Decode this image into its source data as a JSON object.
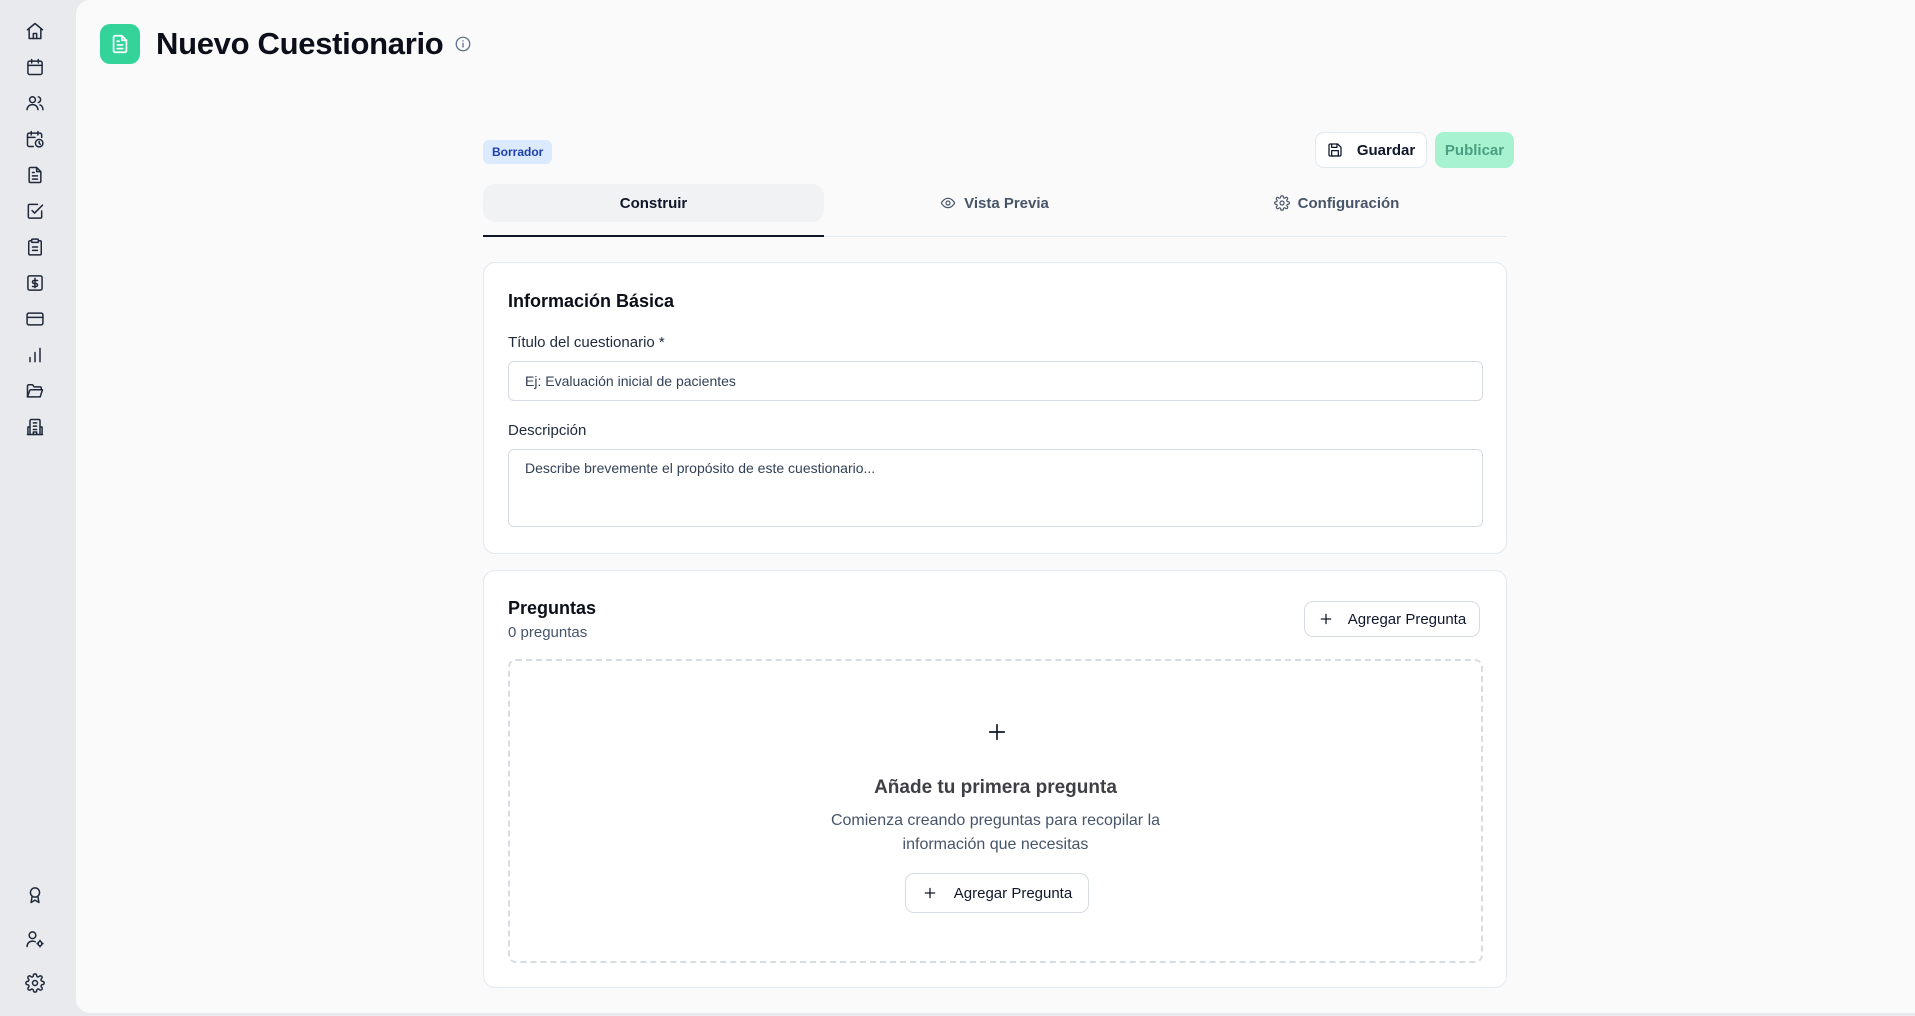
{
  "sidebar": {
    "top_items": [
      {
        "name": "sidebar-item-home",
        "icon": "home-icon"
      },
      {
        "name": "sidebar-item-calendar",
        "icon": "calendar-icon"
      },
      {
        "name": "sidebar-item-users",
        "icon": "users-icon"
      },
      {
        "name": "sidebar-item-schedule",
        "icon": "calendar-clock-icon"
      },
      {
        "name": "sidebar-item-documents",
        "icon": "file-text-icon"
      },
      {
        "name": "sidebar-item-tasks",
        "icon": "check-square-icon"
      },
      {
        "name": "sidebar-item-clipboard",
        "icon": "clipboard-icon"
      },
      {
        "name": "sidebar-item-billing",
        "icon": "dollar-square-icon"
      },
      {
        "name": "sidebar-item-payments",
        "icon": "credit-card-icon"
      },
      {
        "name": "sidebar-item-reports",
        "icon": "bar-chart-icon"
      },
      {
        "name": "sidebar-item-files",
        "icon": "folder-open-icon"
      },
      {
        "name": "sidebar-item-organization",
        "icon": "building-icon"
      }
    ],
    "bottom_items": [
      {
        "name": "sidebar-item-awards",
        "icon": "award-icon"
      },
      {
        "name": "sidebar-item-profile",
        "icon": "user-cog-icon"
      },
      {
        "name": "sidebar-item-settings",
        "icon": "gear-icon"
      }
    ]
  },
  "header": {
    "title": "Nuevo Cuestionario",
    "logo_icon": "file-text-icon",
    "info_icon": "info-icon"
  },
  "toolbar": {
    "status": "Borrador",
    "save_label": "Guardar",
    "publish_label": "Publicar"
  },
  "tabs": [
    {
      "label": "Construir",
      "active": true
    },
    {
      "label": "Vista Previa",
      "icon": "eye-icon",
      "active": false
    },
    {
      "label": "Configuración",
      "icon": "gear-icon",
      "active": false
    }
  ],
  "basic_info": {
    "title": "Información Básica",
    "title_label": "Título del cuestionario *",
    "title_placeholder": "Ej: Evaluación inicial de pacientes",
    "title_value": "",
    "description_label": "Descripción",
    "description_placeholder": "Describe brevemente el propósito de este cuestionario...",
    "description_value": ""
  },
  "questions": {
    "title": "Preguntas",
    "count_text": "0 preguntas",
    "add_label": "Agregar Pregunta",
    "empty_title": "Añade tu primera pregunta",
    "empty_description": "Comienza creando preguntas para recopilar la información que necesitas",
    "empty_add_label": "Agregar Pregunta"
  },
  "colors": {
    "accent": "#34d399",
    "publish_bg": "#a7f3d0",
    "badge_bg": "#dbeafe",
    "badge_text": "#1e40af"
  }
}
